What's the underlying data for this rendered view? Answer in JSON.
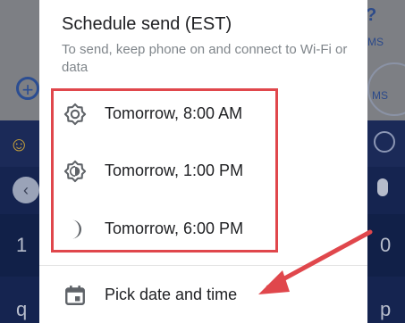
{
  "background": {
    "right_top_char": "?",
    "right_ms_label_1": "MS",
    "right_ms_label_2": "MS",
    "left_num": "1",
    "right_num": "0",
    "left_letter": "q",
    "right_letter": "p"
  },
  "dialog": {
    "title": "Schedule send (EST)",
    "subtitle": "To send, keep phone on and connect to Wi-Fi or data",
    "options": [
      {
        "label": "Tomorrow, 8:00 AM",
        "icon": "morning-sun-icon"
      },
      {
        "label": "Tomorrow, 1:00 PM",
        "icon": "afternoon-sun-icon"
      },
      {
        "label": "Tomorrow, 6:00 PM",
        "icon": "moon-icon"
      }
    ],
    "pick": {
      "label": "Pick date and time",
      "icon": "calendar-icon"
    }
  },
  "annotation": {
    "highlight_color": "#e0474c"
  }
}
